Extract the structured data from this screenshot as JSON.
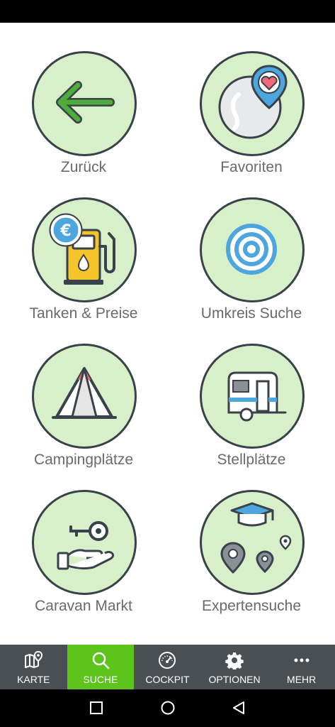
{
  "tiles": [
    {
      "label": "Zurück",
      "icon": "back-arrow-icon"
    },
    {
      "label": "Favoriten",
      "icon": "heart-pin-icon"
    },
    {
      "label": "Tanken & Preise",
      "icon": "fuel-pump-euro-icon"
    },
    {
      "label": "Umkreis Suche",
      "icon": "radius-target-icon"
    },
    {
      "label": "Campingplätze",
      "icon": "tent-icon"
    },
    {
      "label": "Stellplätze",
      "icon": "caravan-icon"
    },
    {
      "label": "Caravan Markt",
      "icon": "key-hand-icon"
    },
    {
      "label": "Expertensuche",
      "icon": "graduation-cap-pins-icon"
    }
  ],
  "bottom_nav": {
    "items": [
      {
        "label": "KARTE",
        "icon": "map-icon"
      },
      {
        "label": "SUCHE",
        "icon": "search-icon",
        "active": true
      },
      {
        "label": "COCKPIT",
        "icon": "speedometer-icon"
      },
      {
        "label": "OPTIONEN",
        "icon": "gear-icon"
      },
      {
        "label": "MEHR",
        "icon": "more-dots-icon"
      }
    ]
  },
  "colors": {
    "tile_fill": "#d8f0c9",
    "tile_border": "#39414a",
    "active_nav": "#5cc41a",
    "nav_background": "#4a4f54"
  }
}
